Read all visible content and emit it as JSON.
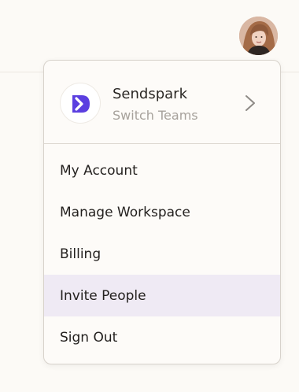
{
  "header": {
    "avatar_icon": "user-avatar"
  },
  "menu": {
    "team": {
      "name": "Sendspark",
      "subtitle": "Switch Teams",
      "logo_icon": "sendspark-logo",
      "logo_color": "#5b3fe0"
    },
    "items": [
      {
        "label": "My Account"
      },
      {
        "label": "Manage Workspace"
      },
      {
        "label": "Billing"
      },
      {
        "label": "Invite People",
        "state": "hovered"
      },
      {
        "label": "Sign Out"
      }
    ],
    "hover_color": "#efeaf4"
  }
}
